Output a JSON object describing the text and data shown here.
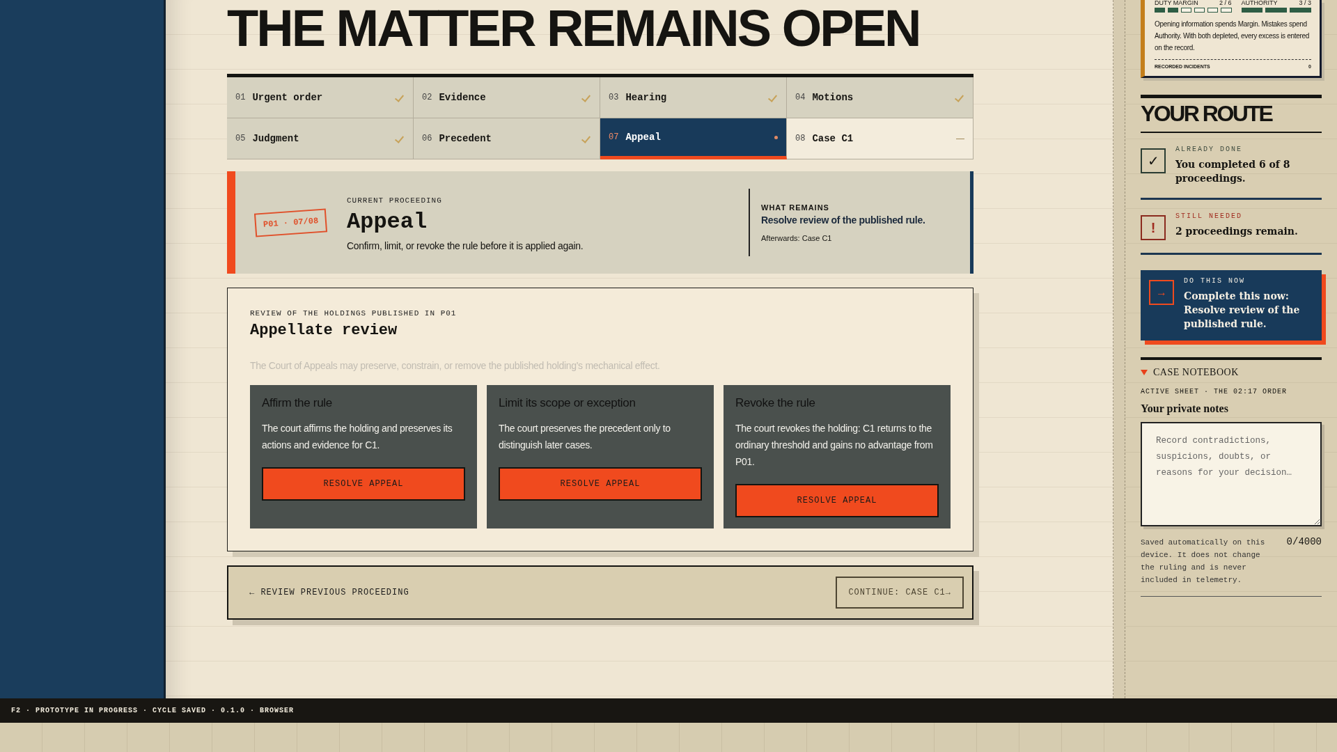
{
  "headline": "THE MATTER REMAINS OPEN",
  "tabs": [
    {
      "number": "01",
      "label": "Urgent order",
      "kind": "done",
      "selected": false
    },
    {
      "number": "02",
      "label": "Evidence",
      "kind": "done",
      "selected": false
    },
    {
      "number": "03",
      "label": "Hearing",
      "kind": "done",
      "selected": false
    },
    {
      "number": "04",
      "label": "Motions",
      "kind": "done",
      "selected": false
    },
    {
      "number": "05",
      "label": "Judgment",
      "kind": "done",
      "selected": false
    },
    {
      "number": "06",
      "label": "Precedent",
      "kind": "done",
      "selected": false
    },
    {
      "number": "07",
      "label": "Appeal",
      "kind": "current",
      "selected": true
    },
    {
      "number": "08",
      "label": "Case C1",
      "kind": "pending",
      "selected": false
    }
  ],
  "current": {
    "stamp": "P01 · 07/08",
    "eyebrow": "CURRENT PROCEEDING",
    "title": "Appeal",
    "description": "Confirm, limit, or revoke the rule before it is applied again.",
    "remains_label": "WHAT REMAINS",
    "remains": "Resolve review of the published rule.",
    "afterwards": "Afterwards: Case C1"
  },
  "review": {
    "eyebrow": "REVIEW OF THE HOLDINGS PUBLISHED IN P01",
    "title": "Appellate review",
    "description": "The Court of Appeals may preserve, constrain, or remove the published holding's mechanical effect.",
    "options": [
      {
        "title": "Affirm the rule",
        "body": "The court affirms the holding and preserves its actions and evidence for C1.",
        "button": "RESOLVE APPEAL"
      },
      {
        "title": "Limit its scope or exception",
        "body": "The court preserves the precedent only to distinguish later cases.",
        "button": "RESOLVE APPEAL"
      },
      {
        "title": "Revoke the rule",
        "body": "The court revokes the holding: C1 returns to the ordinary threshold and gains no advantage from P01.",
        "button": "RESOLVE APPEAL"
      }
    ]
  },
  "navigation": {
    "previous": "← REVIEW PREVIOUS PROCEEDING",
    "next": "CONTINUE: CASE C1→"
  },
  "status_panel": {
    "meters": [
      {
        "label": "DUTY MARGIN",
        "reading": "2 / 6",
        "segments": [
          {
            "filled": true
          },
          {
            "filled": true
          },
          {
            "filled": false
          },
          {
            "filled": false
          },
          {
            "filled": false
          },
          {
            "filled": false
          }
        ]
      },
      {
        "label": "AUTHORITY",
        "reading": "3 / 3",
        "segments": [
          {
            "filled": true
          },
          {
            "filled": true
          },
          {
            "filled": true
          }
        ]
      }
    ],
    "note": "Opening information spends Margin. Mistakes spend Authority. With both depleted, every excess is entered on the record.",
    "incidents_label": "RECORDED INCIDENTS",
    "incidents": "0"
  },
  "route": {
    "title": "YOUR ROUTE",
    "steps": [
      {
        "kind": "done",
        "icon": "✓",
        "label": "ALREADY DONE",
        "text": "You completed 6 of 8 proceedings."
      },
      {
        "kind": "needed",
        "icon": "!",
        "label": "STILL NEEDED",
        "text": "2 proceedings remain."
      },
      {
        "kind": "action",
        "icon": "→",
        "label": "DO THIS NOW",
        "text": "Complete this now: Resolve review of the published rule."
      }
    ]
  },
  "notebook": {
    "title": "CASE NOTEBOOK",
    "expanded": true,
    "sheet": "ACTIVE SHEET · THE 02:17 ORDER",
    "heading": "Your private notes",
    "placeholder": "Record contradictions, suspicions, doubts, or reasons for your decision…",
    "help": "Saved automatically on this device. It does not change the ruling and is never included in telemetry.",
    "counter": "0/4000"
  },
  "status_bar": "F2 · PROTOTYPE IN PROGRESS · CYCLE SAVED · 0.1.0 · BROWSER"
}
